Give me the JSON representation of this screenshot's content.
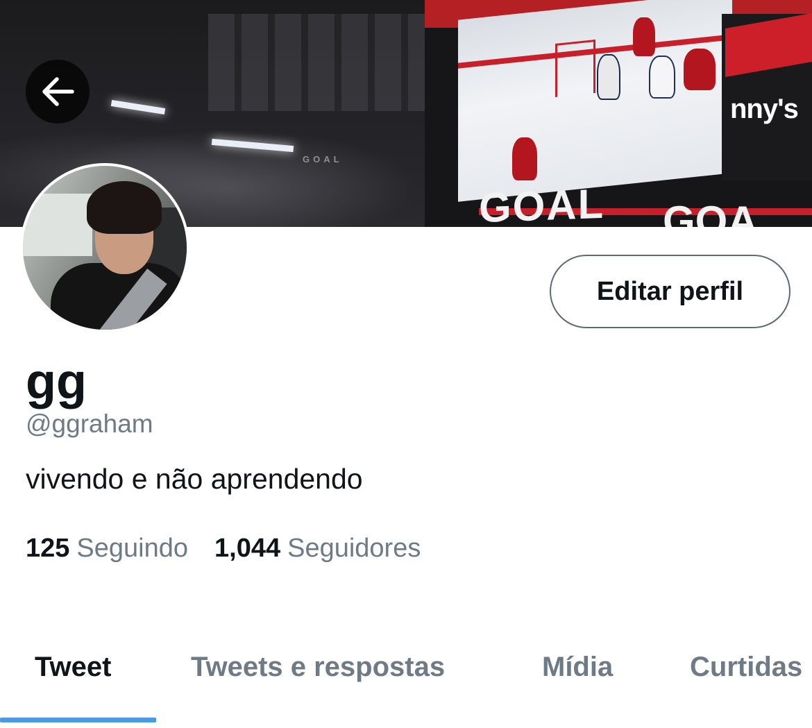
{
  "header": {
    "back_icon": "arrow-left-icon",
    "banner_text": {
      "goal_small": "GOAL",
      "goal_big": "GOAL",
      "goal_big_right": "GOA",
      "ad_right": "nny's"
    }
  },
  "profile": {
    "display_name": "gg",
    "handle": "@ggraham",
    "bio": "vivendo e não aprendendo",
    "edit_button_label": "Editar perfil",
    "following_count": "125",
    "following_label": "Seguindo",
    "followers_count": "1,044",
    "followers_label": "Seguidores"
  },
  "tabs": [
    {
      "label": "Tweet",
      "active": true
    },
    {
      "label": "Tweets e respostas",
      "active": false
    },
    {
      "label": "Mídia",
      "active": false
    },
    {
      "label": "Curtidas",
      "active": false
    }
  ],
  "colors": {
    "text_primary": "#0f1419",
    "text_secondary": "#6e7a86",
    "accent": "#4b9be0",
    "button_border": "#5c6a78"
  }
}
